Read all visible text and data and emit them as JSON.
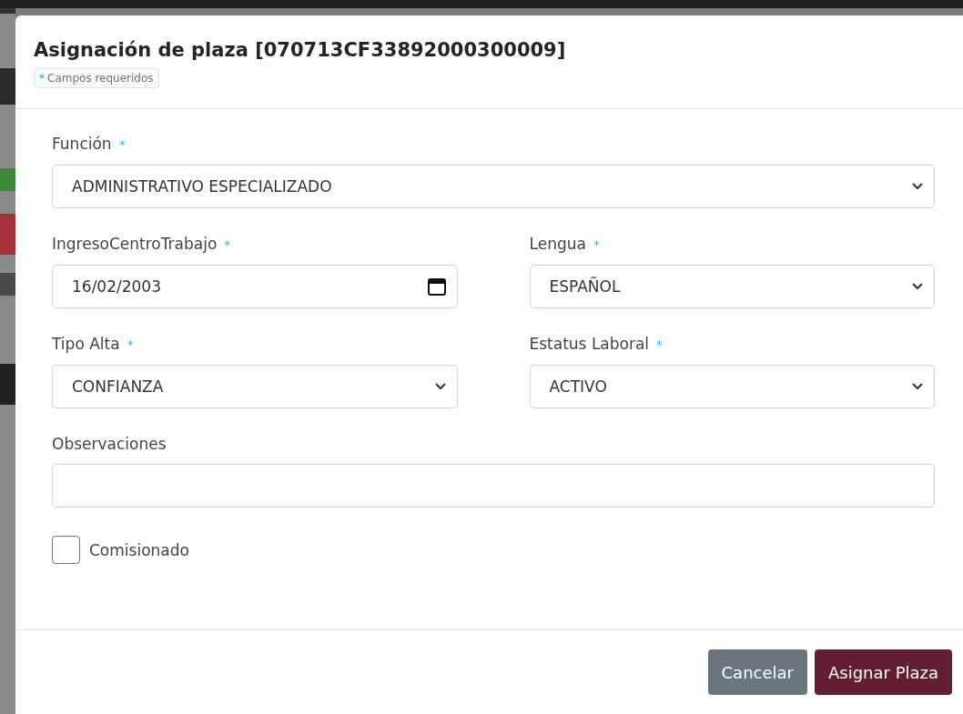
{
  "dialog": {
    "title": "Asignación de plaza [070713CF33892000300009]",
    "badge": {
      "mark": "*",
      "text": "Campos requeridos"
    }
  },
  "rows": [
    {
      "fields": [
        {
          "kind": "select",
          "label": "Función",
          "required_mark": "*",
          "value": "ADMINISTRATIVO ESPECIALIZADO"
        }
      ]
    },
    {
      "fields": [
        {
          "kind": "date",
          "label": "IngresoCentroTrabajo",
          "required_mark": "*",
          "value": "16/02/2003"
        },
        {
          "kind": "select",
          "label": "Lengua",
          "required_mark": "*",
          "value": "ESPAÑOL"
        }
      ]
    },
    {
      "fields": [
        {
          "kind": "select",
          "label": "Tipo Alta",
          "required_mark": "*",
          "value": "CONFIANZA"
        },
        {
          "kind": "select",
          "label": "Estatus Laboral",
          "required_mark": "*",
          "value": "ACTIVO"
        }
      ]
    },
    {
      "fields": [
        {
          "kind": "text",
          "label": "Observaciones"
        }
      ]
    }
  ],
  "checkbox": {
    "label": "Comisionado",
    "checked": false
  },
  "buttons": [
    {
      "kind": "secondary",
      "label": "Cancelar"
    },
    {
      "kind": "primary",
      "label": "Asignar Plaza"
    }
  ]
}
